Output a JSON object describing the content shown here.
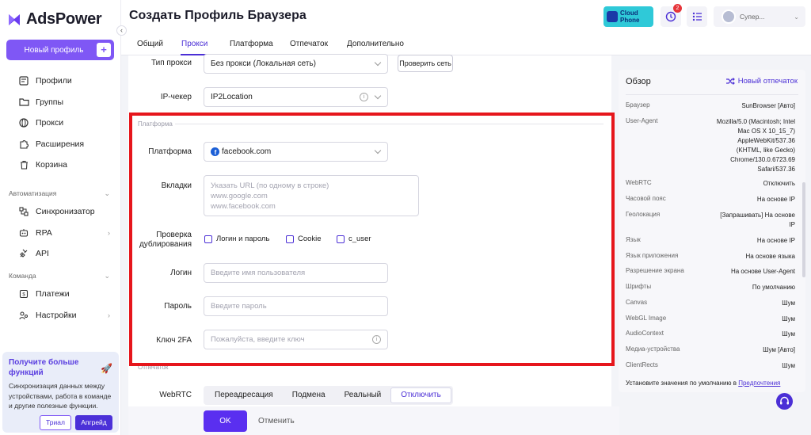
{
  "app": {
    "name": "AdsPower"
  },
  "sidebar": {
    "new_profile": "Новый профиль",
    "items": [
      {
        "label": "Профили",
        "icon": "profiles-icon"
      },
      {
        "label": "Группы",
        "icon": "folder-icon"
      },
      {
        "label": "Прокси",
        "icon": "globe-icon"
      },
      {
        "label": "Расширения",
        "icon": "puzzle-icon"
      },
      {
        "label": "Корзина",
        "icon": "trash-icon"
      }
    ],
    "automation_section": "Автоматизация",
    "automation_items": [
      {
        "label": "Синхронизатор",
        "icon": "sync-icon"
      },
      {
        "label": "RPA",
        "icon": "robot-icon"
      },
      {
        "label": "API",
        "icon": "api-icon"
      }
    ],
    "team_section": "Команда",
    "team_items": [
      {
        "label": "Платежи",
        "icon": "payment-icon"
      },
      {
        "label": "Настройки",
        "icon": "settings-icon"
      }
    ],
    "promo": {
      "title": "Получите больше функций",
      "text": "Синхронизация данных между устройствами, работа в команде и другие полезные функции.",
      "trial": "Триал",
      "upgrade": "Апгрейд"
    }
  },
  "header": {
    "title": "Создать Профиль Браузера",
    "cloud_phone_line1": "Cloud",
    "cloud_phone_line2": "Phone",
    "badge_count": "2",
    "user_name": "Супер..."
  },
  "tabs": [
    "Общий",
    "Прокси",
    "Платформа",
    "Отпечаток",
    "Дополнительно"
  ],
  "active_tab": "Прокси",
  "form": {
    "proxy_type_label": "Тип прокси",
    "proxy_type_value": "Без прокси (Локальная сеть)",
    "check_network": "Проверить сеть",
    "ip_checker_label": "IP-чекер",
    "ip_checker_value": "IP2Location",
    "platform_section": "Платформа",
    "platform_label": "Платформа",
    "platform_value": "facebook.com",
    "tabs_label": "Вкладки",
    "tabs_placeholder_line1": "Указать URL (по одному в строке)",
    "tabs_placeholder_line2": "www.google.com",
    "tabs_placeholder_line3": "www.facebook.com",
    "dup_label_line1": "Проверка",
    "dup_label_line2": "дублирования",
    "dup_options": [
      "Логин и пароль",
      "Cookie",
      "c_user"
    ],
    "login_label": "Логин",
    "login_placeholder": "Введите имя пользователя",
    "password_label": "Пароль",
    "password_placeholder": "Введите пароль",
    "twofa_label": "Ключ 2FA",
    "twofa_placeholder": "Пожалуйста, введите ключ",
    "fingerprint_section": "Отпечаток",
    "webrtc_label": "WebRTC",
    "webrtc_options": [
      "Переадресация",
      "Подмена",
      "Реальный",
      "Отключить"
    ],
    "webrtc_selected": "Отключить",
    "ok": "OK",
    "cancel": "Отменить"
  },
  "overview": {
    "title": "Обзор",
    "new_fingerprint": "Новый отпечаток",
    "rows": [
      {
        "key": "Браузер",
        "value": "SunBrowser [Авто]"
      },
      {
        "key": "User-Agent",
        "value": "Mozilla/5.0 (Macintosh; Intel Mac OS X 10_15_7) AppleWebKit/537.36 (KHTML, like Gecko) Chrome/130.0.6723.69 Safari/537.36"
      },
      {
        "key": "WebRTC",
        "value": "Отключить"
      },
      {
        "key": "Часовой пояс",
        "value": "На основе IP"
      },
      {
        "key": "Геолокация",
        "value": "[Запрашивать] На основе IP"
      },
      {
        "key": "Язык",
        "value": "На основе IP"
      },
      {
        "key": "Язык приложения",
        "value": "На основе языка"
      },
      {
        "key": "Разрешение экрана",
        "value": "На основе User-Agent"
      },
      {
        "key": "Шрифты",
        "value": "По умолчанию"
      },
      {
        "key": "Canvas",
        "value": "Шум"
      },
      {
        "key": "WebGL Image",
        "value": "Шум"
      },
      {
        "key": "AudioContext",
        "value": "Шум"
      },
      {
        "key": "Медиа-устройства",
        "value": "Шум [Авто]"
      },
      {
        "key": "ClientRects",
        "value": "Шум"
      }
    ],
    "footer_text": "Установите значения по умолчанию в",
    "footer_link": "Предпочтения"
  },
  "colors": {
    "accent": "#4b2fd6",
    "primary_button": "#5a2ff0",
    "highlight_frame": "#e6161c"
  }
}
